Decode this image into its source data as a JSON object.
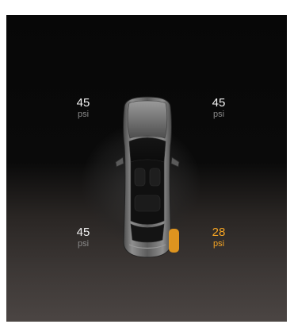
{
  "tires": {
    "front_left": {
      "value": "45",
      "unit": "psi",
      "status": "normal"
    },
    "front_right": {
      "value": "45",
      "unit": "psi",
      "status": "normal"
    },
    "rear_left": {
      "value": "45",
      "unit": "psi",
      "status": "normal"
    },
    "rear_right": {
      "value": "28",
      "unit": "psi",
      "status": "low"
    }
  },
  "colors": {
    "normal_text": "#f2f2f2",
    "unit_text": "#8a8a8a",
    "alert": "#f5a524"
  },
  "icons": [
    "car-topview-icon",
    "low-pressure-tire-highlight-icon"
  ]
}
